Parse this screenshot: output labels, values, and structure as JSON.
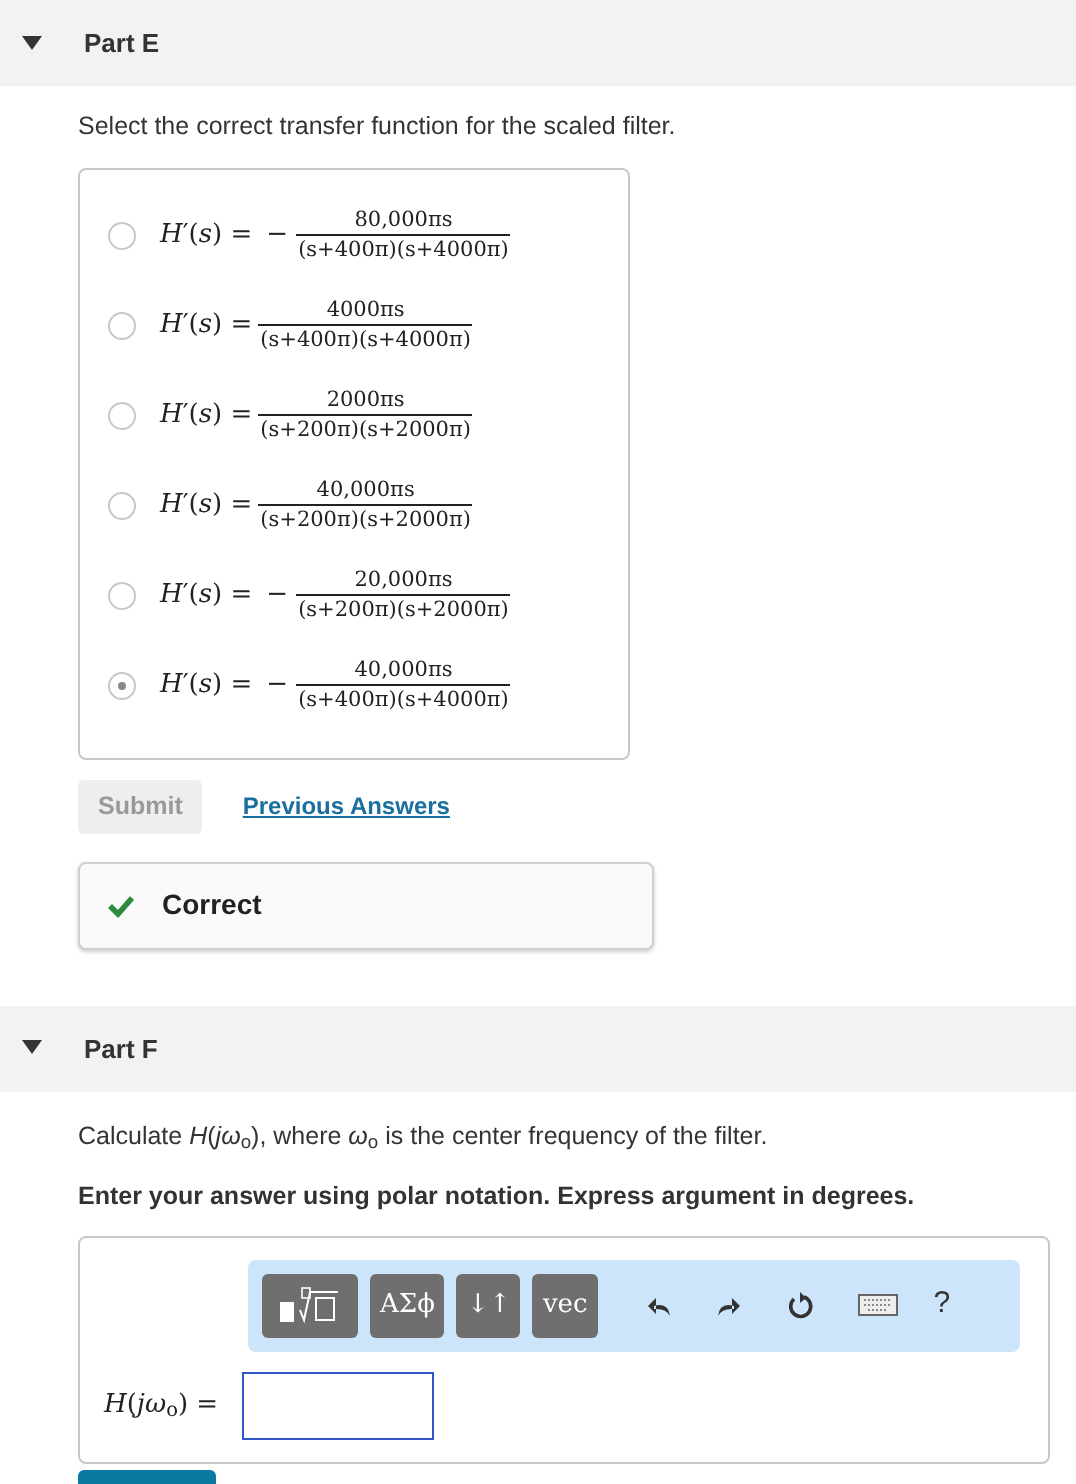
{
  "part_e": {
    "title": "Part E",
    "expanded": true,
    "prompt": "Select the correct transfer function for the scaled filter.",
    "options": [
      {
        "lhs": "*H*′(*s*) =",
        "sign": "−",
        "numerator": "80,000πs",
        "denominator": "(s+400π)(s+4000π)",
        "selected": false
      },
      {
        "lhs": "*H*′(*s*) =",
        "numerator": "4000πs",
        "denominator": "(s+400π)(s+4000π)",
        "selected": false
      },
      {
        "lhs": "*H*′(*s*) =",
        "numerator": "2000πs",
        "denominator": "(s+200π)(s+2000π)",
        "selected": false
      },
      {
        "lhs": "*H*′(*s*) =",
        "numerator": "40,000πs",
        "denominator": "(s+200π)(s+2000π)",
        "selected": false
      },
      {
        "lhs": "*H*′(*s*) =",
        "sign": "−",
        "numerator": "20,000πs",
        "denominator": "(s+200π)(s+2000π)",
        "selected": false
      },
      {
        "lhs": "*H*′(*s*) =",
        "sign": "−",
        "numerator": "40,000πs",
        "denominator": "(s+400π)(s+4000π)",
        "selected": true
      }
    ],
    "submit": {
      "label": "Submit",
      "disabled": true
    },
    "previous_answers": "Previous Answers",
    "feedback": "Correct"
  },
  "part_f": {
    "title": "Part F",
    "expanded": true,
    "prompt": "Calculate *H*(*jω*$_{o}$), where *ω*$_{o}$ is the center frequency of the filter.",
    "instruction": "Enter your answer using polar notation. Express argument in degrees.",
    "toolbar": [
      {
        "kind": "template"
      },
      {
        "kind": "button",
        "label": "ΑΣϕ"
      },
      {
        "kind": "button",
        "label": "↓↑"
      },
      {
        "kind": "button",
        "label": "vec"
      },
      {
        "kind": "undo"
      },
      {
        "kind": "redo"
      },
      {
        "kind": "reset"
      },
      {
        "kind": "keyboard"
      },
      {
        "kind": "text",
        "label": "?"
      }
    ],
    "answer_label": "*H*(*jω*$_{o}$) ="
  }
}
